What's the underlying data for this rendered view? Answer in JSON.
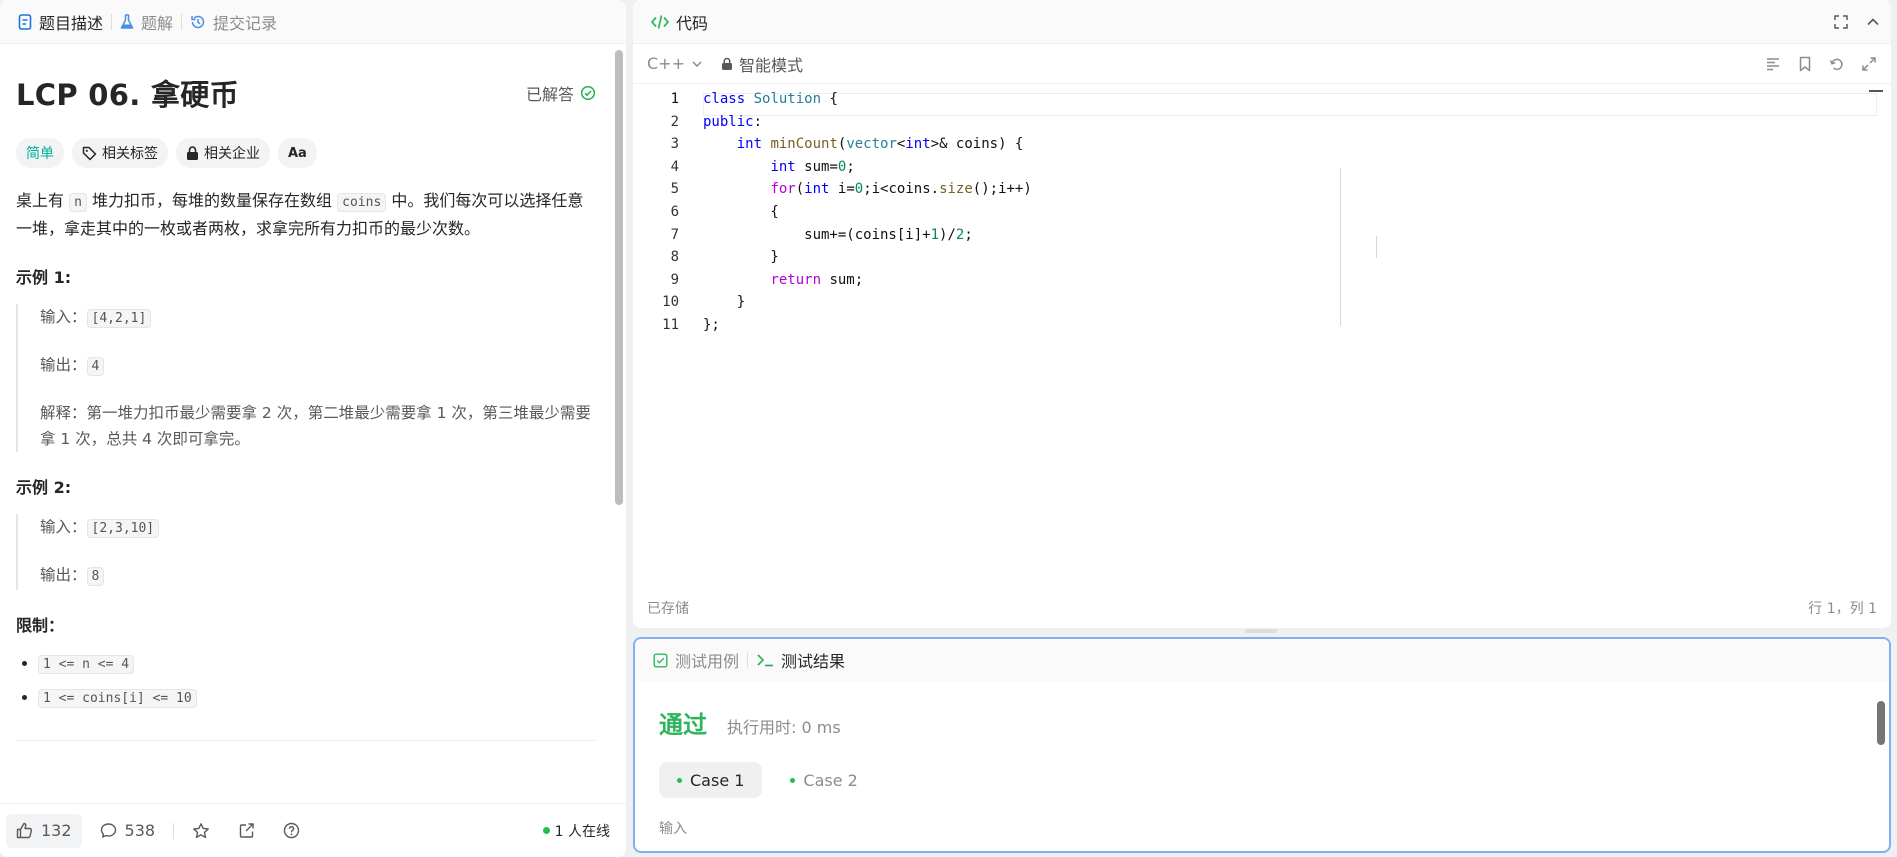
{
  "left": {
    "tabs": [
      {
        "label": "题目描述",
        "icon": "doc-icon"
      },
      {
        "label": "题解",
        "icon": "flask-icon"
      },
      {
        "label": "提交记录",
        "icon": "history-icon"
      }
    ],
    "title": "LCP 06. 拿硬币",
    "solved": "已解答",
    "tags": {
      "difficulty": "简单",
      "topics": "相关标签",
      "companies": "相关企业",
      "font": "Aa"
    },
    "desc_1": "桌上有",
    "desc_n": "n",
    "desc_2": "堆力扣币，每堆的数量保存在数组",
    "desc_coins": "coins",
    "desc_3": "中。我们每次可以选择任意一堆，拿走其中的一枚或者两枚，求拿完所有力扣币的最少次数。",
    "ex1_title": "示例 1:",
    "ex1_in_label": "输入：",
    "ex1_in": "[4,2,1]",
    "ex1_out_label": "输出：",
    "ex1_out": "4",
    "ex1_expl": "解释：第一堆力扣币最少需要拿 2 次，第二堆最少需要拿 1 次，第三堆最少需要拿 1 次，总共 4 次即可拿完。",
    "ex2_title": "示例 2:",
    "ex2_in_label": "输入：",
    "ex2_in": "[2,3,10]",
    "ex2_out_label": "输出：",
    "ex2_out": "8",
    "limits_title": "限制：",
    "limits": [
      "1 <= n <= 4",
      "1 <= coins[i] <= 10"
    ],
    "bottom": {
      "likes": "132",
      "comments": "538",
      "online": "1 人在线"
    }
  },
  "editor": {
    "title": "代码",
    "language": "C++",
    "mode": "智能模式",
    "status_saved": "已存储",
    "cursor": "行 1，列 1",
    "line_numbers": [
      "1",
      "2",
      "3",
      "4",
      "5",
      "6",
      "7",
      "8",
      "9",
      "10",
      "11"
    ]
  },
  "result": {
    "tab_cases": "测试用例",
    "tab_result": "测试结果",
    "status": "通过",
    "runtime": "执行用时: 0 ms",
    "case1": "Case 1",
    "case2": "Case 2",
    "input_label": "输入"
  }
}
